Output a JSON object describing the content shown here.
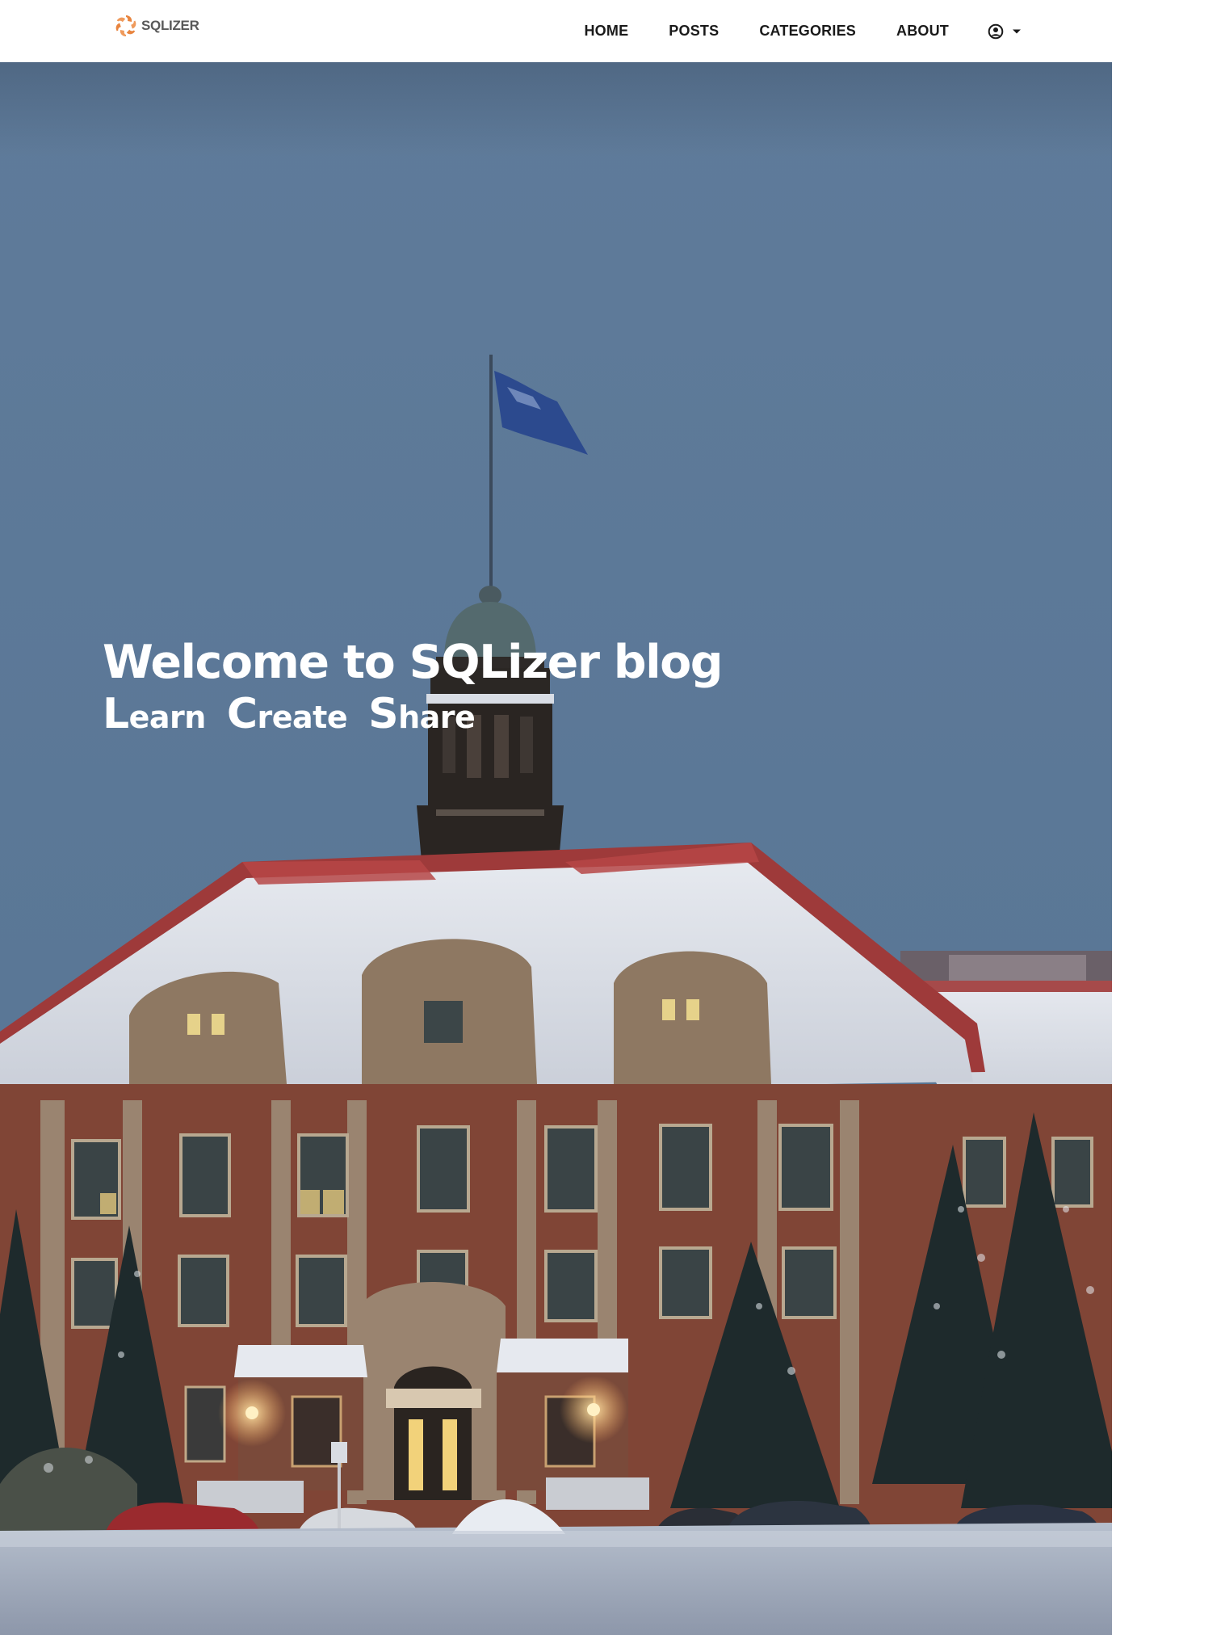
{
  "navbar": {
    "brand": {
      "logo_icon": "sqlizer-pinwheel-logo",
      "name": "SQLIZER",
      "accent_color": "#e8843f"
    },
    "links": [
      {
        "label": "HOME"
      },
      {
        "label": "POSTS"
      },
      {
        "label": "CATEGORIES"
      },
      {
        "label": "ABOUT"
      }
    ],
    "user_menu": {
      "icon": "user-circle-icon",
      "caret": "caret-down-icon"
    }
  },
  "hero": {
    "background": "photo of a red-brick campus building with a snow-covered roof, a domed clock tower and a flag, at dusk in winter",
    "title": "Welcome to SQLizer blog",
    "tagline": [
      {
        "initial": "L",
        "rest": "earn"
      },
      {
        "initial": "C",
        "rest": "reate"
      },
      {
        "initial": "S",
        "rest": "hare"
      }
    ]
  }
}
